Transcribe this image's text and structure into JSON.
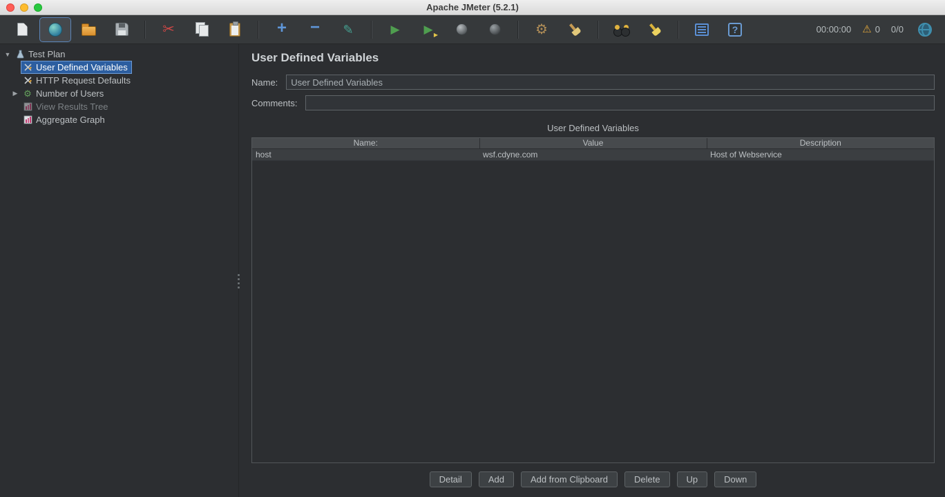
{
  "window": {
    "title": "Apache JMeter (5.2.1)"
  },
  "toolbar": {
    "timer": "00:00:00",
    "warning_count": "0",
    "thread_count": "0/0",
    "glyphs": {
      "cut": "✂",
      "add": "+",
      "remove": "−",
      "toggle": "✎",
      "start": "▶",
      "start_badge": "▶",
      "clear_gear": "⚙",
      "warning": "⚠",
      "help": "?"
    },
    "icon_names": [
      "new-file",
      "templates",
      "open-file",
      "save",
      "cut",
      "copy",
      "paste",
      "add",
      "remove",
      "toggle",
      "start",
      "start-no-pauses",
      "stop",
      "shutdown",
      "clear",
      "clear-all",
      "search",
      "search-reset",
      "function-helper",
      "help",
      "globe"
    ]
  },
  "tree": {
    "glyphs": {
      "expanded": "▼",
      "collapsed": "▶",
      "thread_gear": "⚙"
    },
    "items": [
      {
        "label": "Test Plan"
      },
      {
        "label": "User Defined Variables"
      },
      {
        "label": "HTTP Request Defaults"
      },
      {
        "label": "Number of Users"
      },
      {
        "label": "View Results Tree"
      },
      {
        "label": "Aggregate Graph"
      }
    ]
  },
  "main": {
    "title": "User Defined Variables",
    "name_label": "Name:",
    "name_value": "User Defined Variables",
    "comments_label": "Comments:",
    "comments_value": "",
    "table_title": "User Defined Variables",
    "table": {
      "columns": [
        "Name:",
        "Value",
        "Description"
      ],
      "rows": [
        [
          "host",
          "wsf.cdyne.com",
          "Host of Webservice"
        ]
      ]
    },
    "buttons": [
      "Detail",
      "Add",
      "Add from Clipboard",
      "Delete",
      "Up",
      "Down"
    ]
  }
}
